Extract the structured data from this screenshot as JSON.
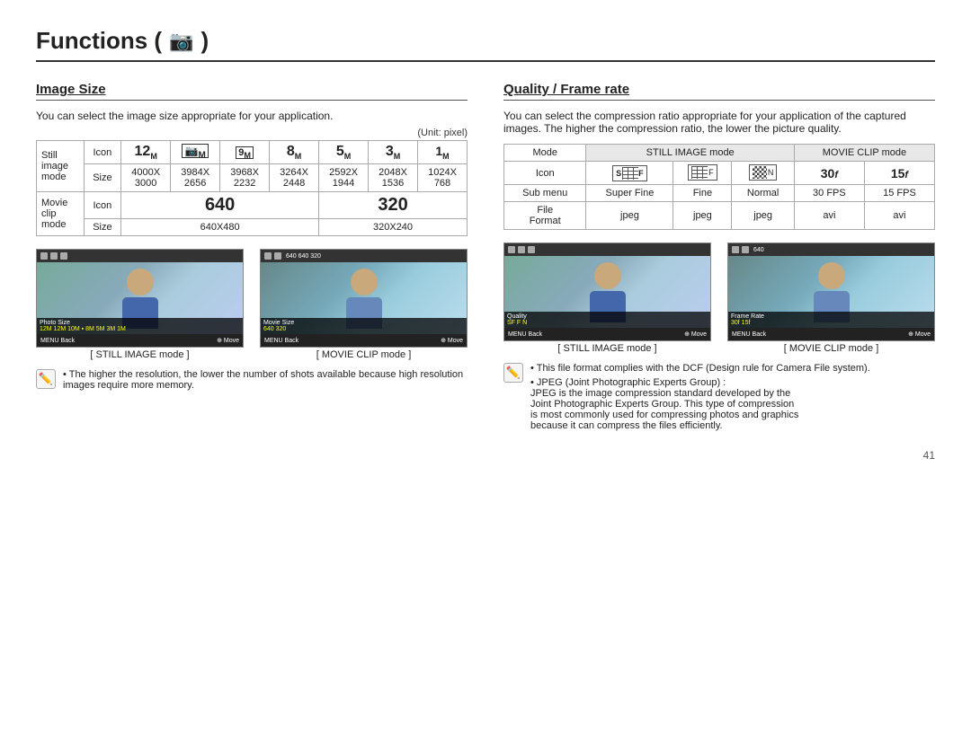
{
  "page": {
    "title": "Functions (",
    "title_icon": "📷",
    "page_number": "41"
  },
  "image_size": {
    "section_title": "Image Size",
    "description": "You can select the image size appropriate for your application.",
    "unit_note": "(Unit: pixel)",
    "table": {
      "rows": [
        {
          "mode_label": "Still image mode",
          "row_type": "icon",
          "col_label": "Icon",
          "cols": [
            "12M",
            "10M",
            "9M",
            "8M",
            "5M",
            "3M",
            "1M"
          ]
        },
        {
          "row_type": "size",
          "col_label": "Size",
          "cols": [
            "4000X\n3000",
            "3984X\n2656",
            "3968X\n2232",
            "3264X\n2448",
            "2592X\n1944",
            "2048X\n1536",
            "1024X\n768"
          ]
        },
        {
          "mode_label": "Movie clip mode",
          "row_type": "icon",
          "col_label": "Icon",
          "col_640": "640",
          "col_320": "320"
        },
        {
          "row_type": "size",
          "col_label": "Size",
          "col_640": "640X480",
          "col_320": "320X240"
        }
      ]
    },
    "screenshots": [
      {
        "caption": "[ STILL IMAGE mode ]"
      },
      {
        "caption": "[ MOVIE CLIP mode ]"
      }
    ],
    "note": "The higher the resolution, the lower the number of shots available because high resolution images require more memory."
  },
  "quality": {
    "section_title": "Quality / Frame rate",
    "description": "You can select the compression ratio appropriate for your application of the captured images. The higher the compression ratio, the lower the picture quality.",
    "table": {
      "headers": [
        "Mode",
        "STILL IMAGE mode",
        "MOVIE CLIP mode"
      ],
      "row_icon_label": "Icon",
      "row_submenu_label": "Sub menu",
      "row_file_label": "File Format",
      "icons": [
        "SF",
        "F",
        "N",
        "30f",
        "15f"
      ],
      "submenus": [
        "Super Fine",
        "Fine",
        "Normal",
        "30 FPS",
        "15 FPS"
      ],
      "formats": [
        "jpeg",
        "jpeg",
        "jpeg",
        "avi",
        "avi"
      ]
    },
    "screenshots": [
      {
        "caption": "[ STILL IMAGE mode ]"
      },
      {
        "caption": "[ MOVIE CLIP mode ]"
      }
    ],
    "notes": [
      "This file format complies with the DCF (Design rule for Camera File system).",
      "JPEG (Joint Photographic Experts Group) :\nJPEG is the image compression standard developed by the Joint Photographic Experts Group. This type of compression is most commonly used for compressing photos and graphics because it can compress the files efficiently."
    ]
  }
}
